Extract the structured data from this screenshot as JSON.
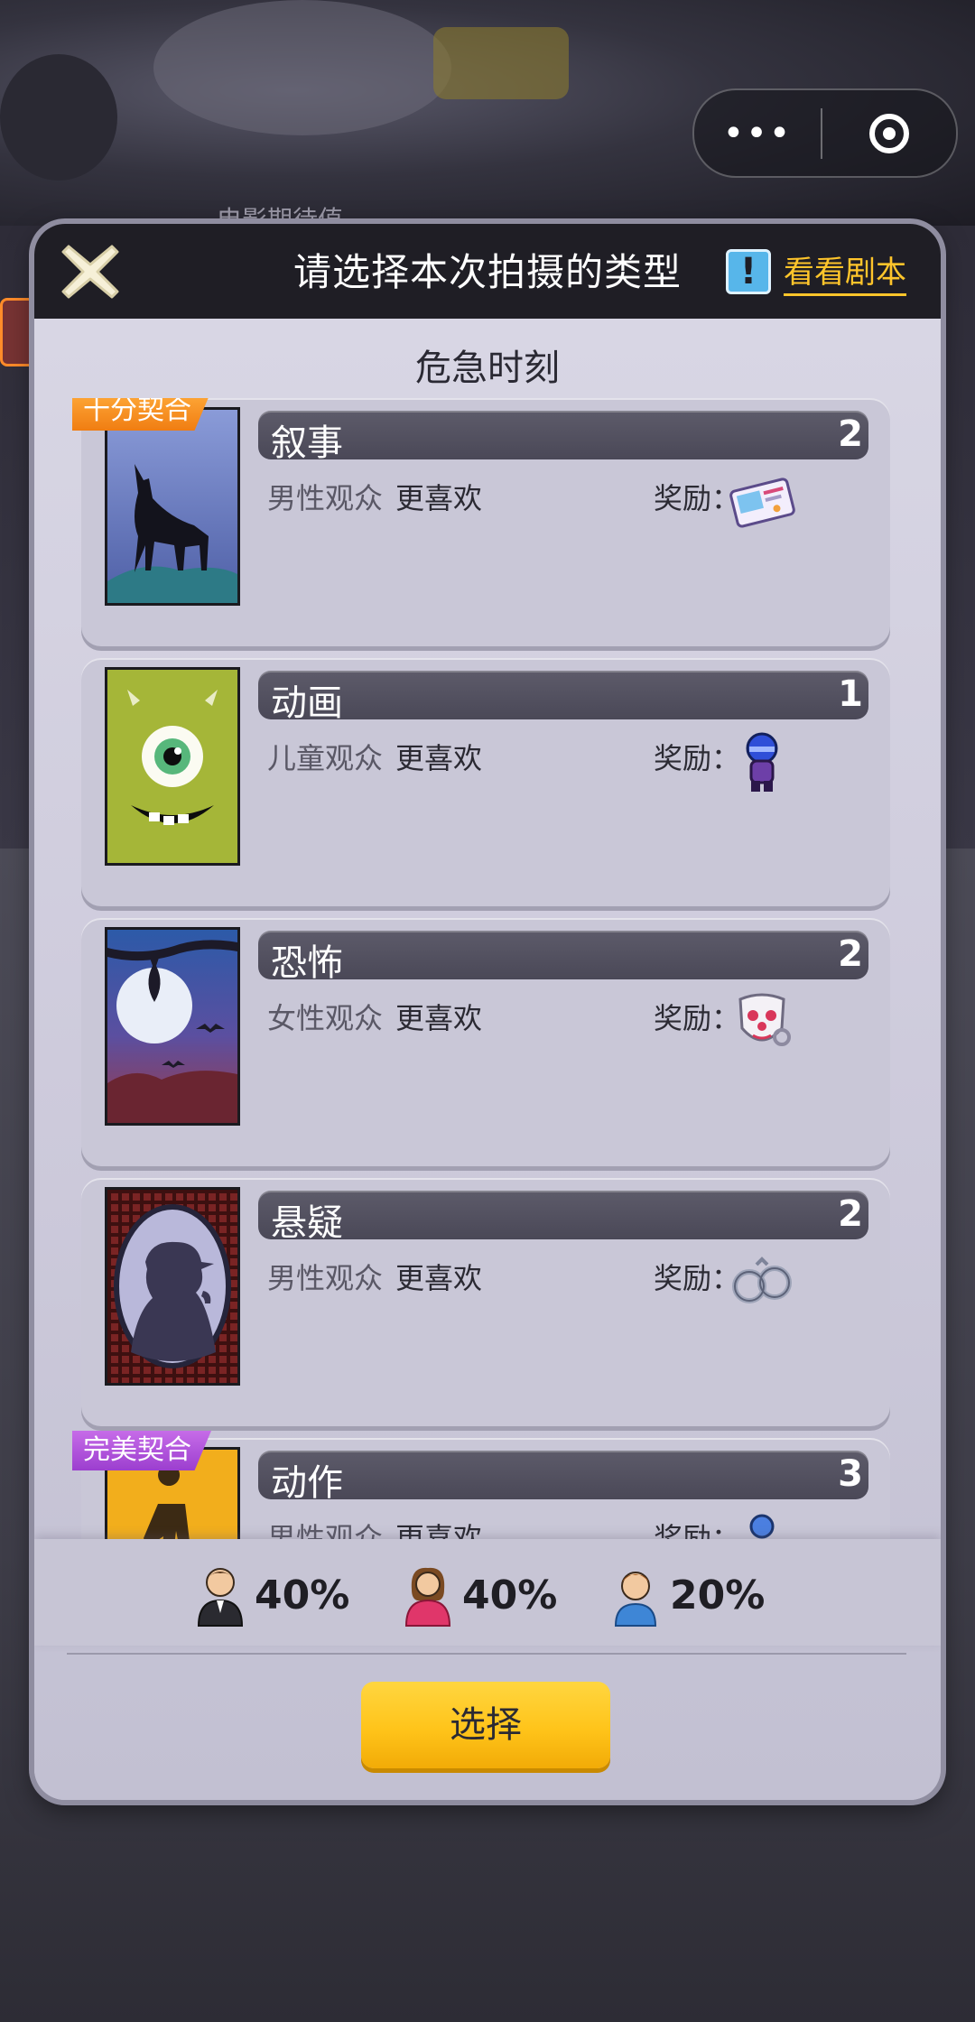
{
  "background": {
    "peek_text": "电影期待值"
  },
  "capsule": {
    "more_glyph": "•••",
    "close_icon": "target-icon"
  },
  "dialog": {
    "title": "请选择本次拍摄的类型",
    "script_link_glyph": "!",
    "script_link_label": "看看剧本",
    "script_name": "危急时刻",
    "reward_label": "奖励：",
    "preference_suffix": "更喜欢",
    "genres": [
      {
        "name": "叙事",
        "count": "2",
        "audience": "男性观众",
        "badge": "十分契合",
        "badge_color": "#f6901e",
        "reward_icon": "ticket-card-icon"
      },
      {
        "name": "动画",
        "count": "1",
        "audience": "儿童观众",
        "badge": "",
        "reward_icon": "blue-figure-icon"
      },
      {
        "name": "恐怖",
        "count": "2",
        "audience": "女性观众",
        "badge": "",
        "reward_icon": "clown-mask-icon"
      },
      {
        "name": "悬疑",
        "count": "2",
        "audience": "男性观众",
        "badge": "",
        "reward_icon": "handcuffs-icon"
      },
      {
        "name": "动作",
        "count": "3",
        "audience": "男性观众",
        "badge": "完美契合",
        "badge_color": "#b14fdc",
        "reward_icon": "blue-figure-icon"
      }
    ],
    "audience_share": [
      {
        "group": "male",
        "icon": "man-avatar-icon",
        "percent": "40%"
      },
      {
        "group": "female",
        "icon": "woman-avatar-icon",
        "percent": "40%"
      },
      {
        "group": "child",
        "icon": "child-avatar-icon",
        "percent": "20%"
      }
    ],
    "select_button": "选择"
  }
}
